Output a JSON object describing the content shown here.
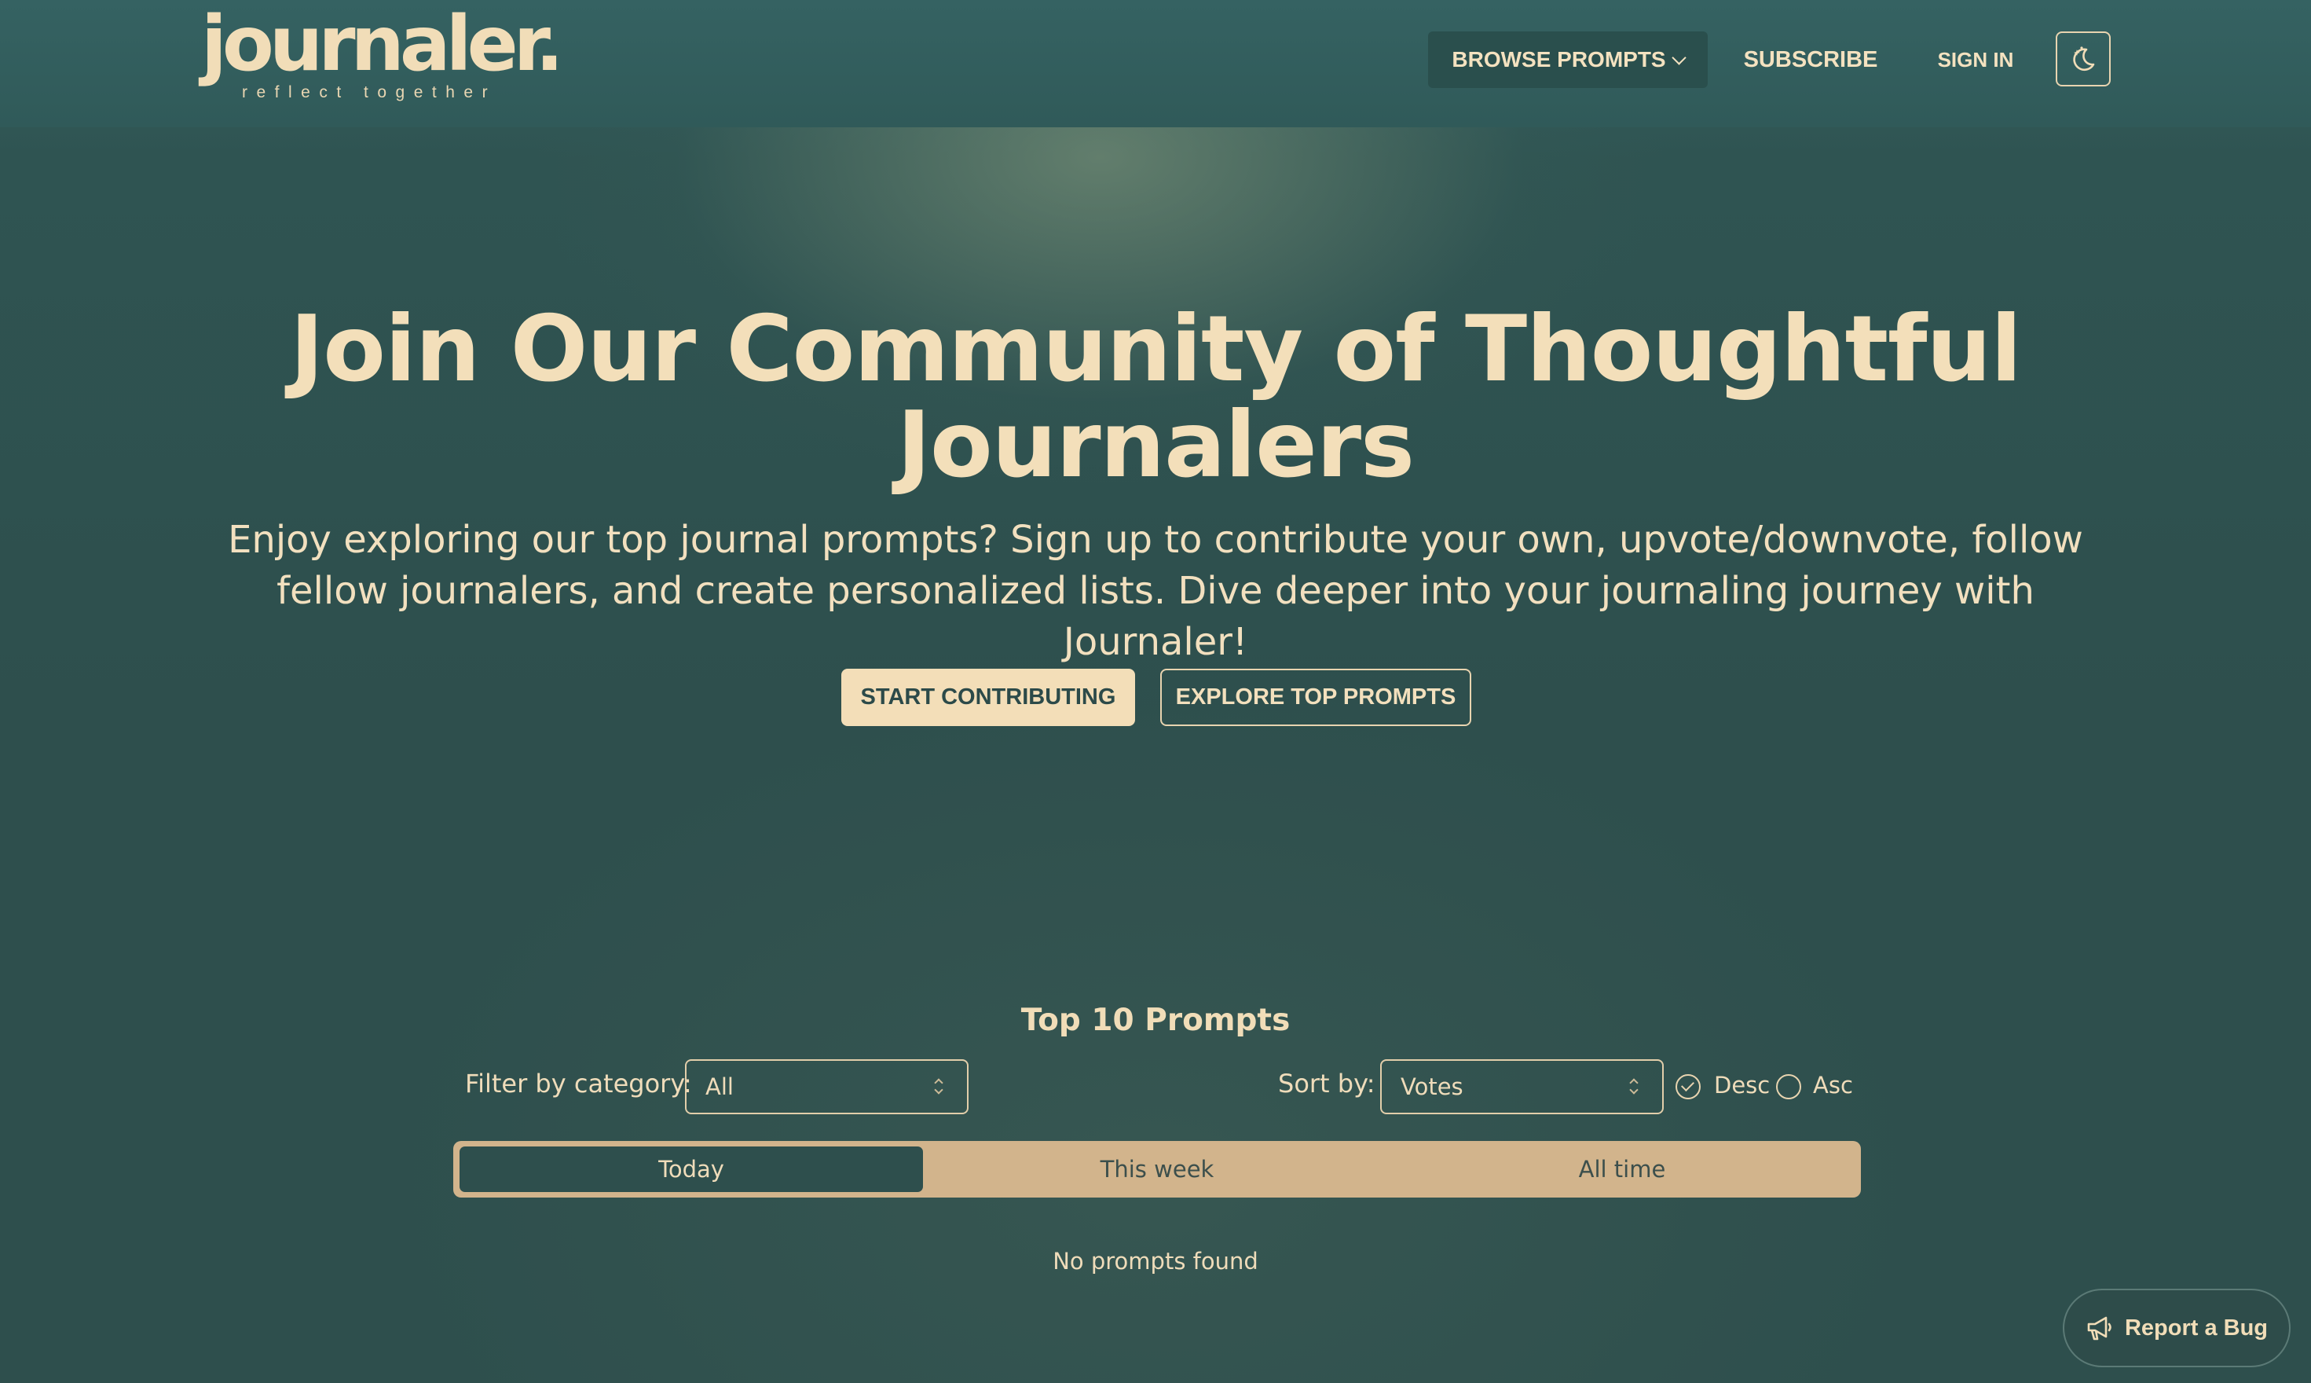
{
  "header": {
    "logo_text": "journaler.",
    "logo_tagline": "reflect together",
    "nav": {
      "browse_label": "BROWSE PROMPTS",
      "subscribe_label": "SUBSCRIBE",
      "signin_label": "SIGN IN"
    },
    "theme_toggle_icon": "moon-stars-icon"
  },
  "hero": {
    "title": "Join Our Community of Thoughtful Journalers",
    "subtitle": "Enjoy exploring our top journal prompts? Sign up to contribute your own, upvote/downvote, follow fellow journalers, and create personalized lists. Dive deeper into your journaling journey with Journaler!",
    "primary_button": "START CONTRIBUTING",
    "secondary_button": "EXPLORE TOP PROMPTS"
  },
  "top_prompts": {
    "title": "Top 10 Prompts",
    "filter_label": "Filter by category:",
    "filter_value": "All",
    "sort_label": "Sort by:",
    "sort_value": "Votes",
    "order_options": [
      {
        "label": "Desc",
        "selected": true
      },
      {
        "label": "Asc",
        "selected": false
      }
    ],
    "periods": [
      {
        "label": "Today",
        "active": true
      },
      {
        "label": "This week",
        "active": false
      },
      {
        "label": "All time",
        "active": false
      }
    ],
    "empty_message": "No prompts found"
  },
  "report_bug": {
    "label": "Report a Bug",
    "icon": "megaphone-icon"
  },
  "colors": {
    "background": "#2f4f4e",
    "accent": "#f3deb8",
    "segment_bg": "#d2b48c"
  }
}
